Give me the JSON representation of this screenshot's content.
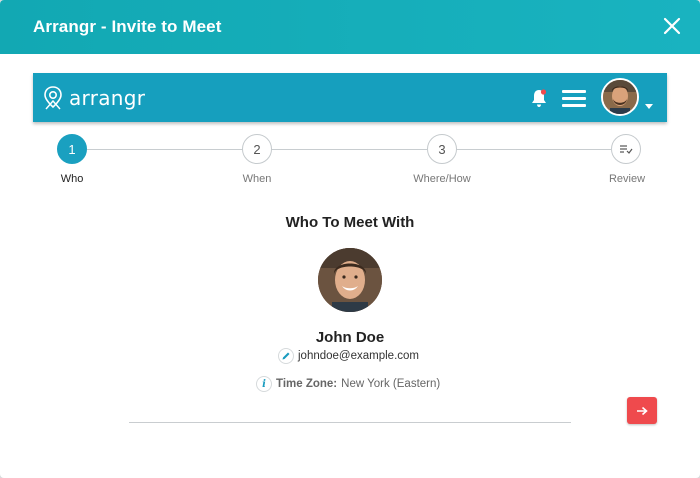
{
  "modal": {
    "title": "Arrangr - Invite to Meet"
  },
  "appbar": {
    "logo_text": "arrangr",
    "icons": [
      "bell-icon",
      "menu-icon",
      "user-avatar",
      "chevron-down-icon"
    ]
  },
  "stepper": {
    "steps": [
      {
        "number": "1",
        "label": "Who",
        "active": true
      },
      {
        "number": "2",
        "label": "When",
        "active": false
      },
      {
        "number": "3",
        "label": "Where/How",
        "active": false
      },
      {
        "number": "",
        "label": "Review",
        "icon": "review-list-icon",
        "active": false
      }
    ]
  },
  "main": {
    "section_title": "Who To Meet With",
    "person": {
      "name": "John Doe",
      "email": "johndoe@example.com",
      "timezone_label": "Time Zone:",
      "timezone_value": "New York (Eastern)"
    }
  },
  "colors": {
    "header_teal": "#12a8b3",
    "appbar_blue": "#169fbe",
    "active_step": "#1aa0c0",
    "next_button": "#ef4a4d"
  }
}
